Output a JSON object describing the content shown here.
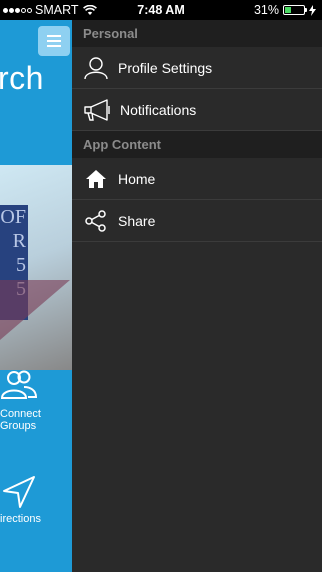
{
  "status_bar": {
    "carrier": "SMART",
    "time": "7:48 AM",
    "battery_percent": "31%",
    "signal_bars_filled": 3,
    "signal_bars_total": 5,
    "battery_level": 0.31,
    "battery_color": "#4cd964"
  },
  "background_app": {
    "title_fragment": "rch",
    "accent_color": "#1e9ad6",
    "hero_sign_text": "OF\nR\n5\n5",
    "tiles": [
      {
        "label_line1": "Connect",
        "label_line2": "Groups",
        "icon": "people-icon"
      },
      {
        "label_line1": "irections",
        "icon": "navigation-arrow-icon"
      }
    ]
  },
  "drawer": {
    "sections": [
      {
        "title": "Personal",
        "items": [
          {
            "label": "Profile Settings",
            "icon": "person-icon"
          },
          {
            "label": "Notifications",
            "icon": "megaphone-icon"
          }
        ]
      },
      {
        "title": "App Content",
        "items": [
          {
            "label": "Home",
            "icon": "home-icon"
          },
          {
            "label": "Share",
            "icon": "share-icon"
          }
        ]
      }
    ]
  }
}
